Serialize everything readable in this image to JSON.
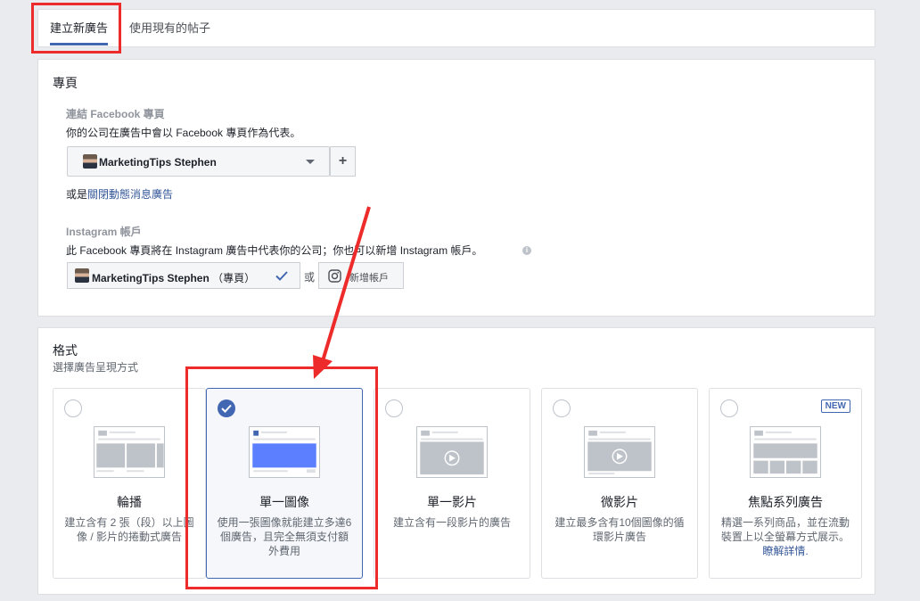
{
  "tabs": [
    {
      "label": "建立新廣告",
      "active": true
    },
    {
      "label": "使用現有的帖子",
      "active": false
    }
  ],
  "page_section": {
    "title": "專頁",
    "connect_label": "連結 Facebook 專頁",
    "connect_desc": "你的公司在廣告中會以 Facebook 專頁作為代表。",
    "page_select_value": "MarketingTips Stephen",
    "add_button": "+",
    "or_prefix": "或是",
    "turn_off_link": "關閉動態消息廣告",
    "instagram_label": "Instagram 帳戶",
    "instagram_desc": "此 Facebook 專頁將在 Instagram 廣告中代表你的公司；你也可以新增 Instagram 帳戶。",
    "ig_account_name": "MarketingTips Stephen",
    "ig_account_note": "（專頁）",
    "or_word": "或",
    "add_account_label": "新增帳戶"
  },
  "format_section": {
    "title": "格式",
    "subtitle": "選擇廣告呈現方式",
    "cards": [
      {
        "title": "輪播",
        "desc": "建立含有 2 張（段）以上圖像 / 影片的捲動式廣告",
        "selected": false
      },
      {
        "title": "單一圖像",
        "desc": "使用一張圖像就能建立多達6個廣告，且完全無須支付額外費用",
        "selected": true
      },
      {
        "title": "單一影片",
        "desc": "建立含有一段影片的廣告",
        "selected": false
      },
      {
        "title": "微影片",
        "desc": "建立最多含有10個圖像的循環影片廣告",
        "selected": false
      },
      {
        "title": "焦點系列廣告",
        "desc": "精選一系列商品，並在流動裝置上以全螢幕方式展示。",
        "learn_more": "瞭解詳情.",
        "badge": "NEW",
        "selected": false
      }
    ]
  },
  "colors": {
    "accent": "#4267b2",
    "annotation_red": "#ee2b2b",
    "link": "#365899"
  }
}
